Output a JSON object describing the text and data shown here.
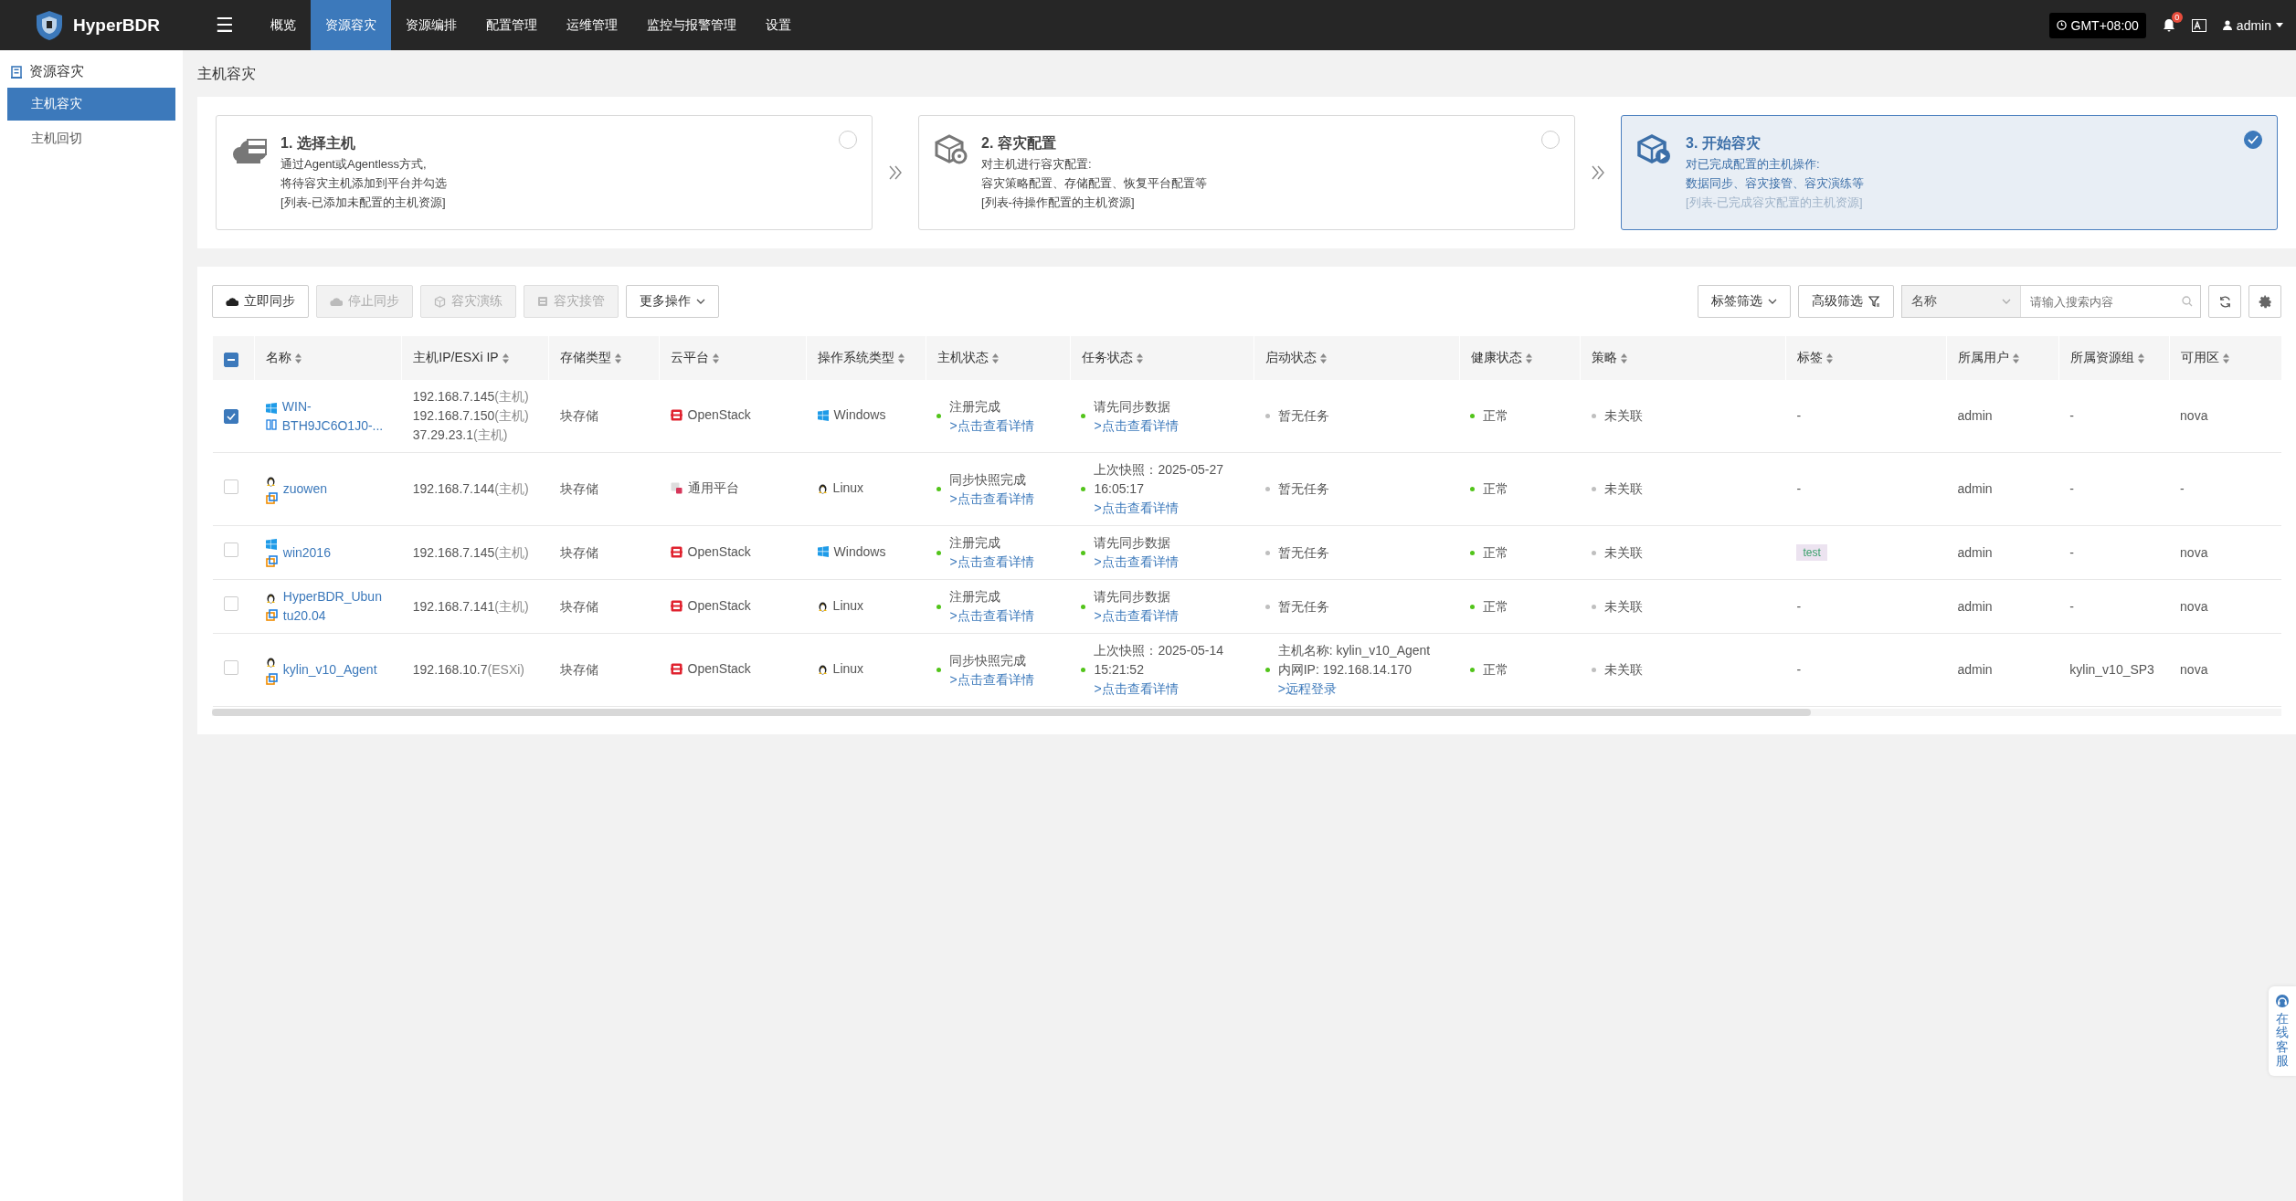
{
  "topbar": {
    "brand": "HyperBDR",
    "menu_icon": "☰",
    "nav": [
      {
        "label": "概览",
        "selected": false
      },
      {
        "label": "资源容灾",
        "selected": true
      },
      {
        "label": "资源编排",
        "selected": false
      },
      {
        "label": "配置管理",
        "selected": false
      },
      {
        "label": "运维管理",
        "selected": false
      },
      {
        "label": "监控与报警管理",
        "selected": false
      },
      {
        "label": "设置",
        "selected": false
      }
    ],
    "timezone": "GMT+08:00",
    "alert_count": "0",
    "user": "admin"
  },
  "sidebar": {
    "section": "资源容灾",
    "items": [
      {
        "label": "主机容灾",
        "selected": true
      },
      {
        "label": "主机回切",
        "selected": false
      }
    ]
  },
  "page_title": "主机容灾",
  "steps": [
    {
      "kind": "cloud",
      "title": "1. 选择主机",
      "lines": [
        "通过Agent或Agentless方式,",
        "将待容灾主机添加到平台并勾选"
      ],
      "note": "[列表-已添加未配置的主机资源]",
      "selected": false
    },
    {
      "kind": "config",
      "title": "2. 容灾配置",
      "lines": [
        "对主机进行容灾配置:",
        "容灾策略配置、存储配置、恢复平台配置等"
      ],
      "note": "[列表-待操作配置的主机资源]",
      "selected": false
    },
    {
      "kind": "start",
      "title": "3. 开始容灾",
      "lines": [
        "对已完成配置的主机操作:",
        "数据同步、容灾接管、容灾演练等"
      ],
      "note": "[列表-已完成容灾配置的主机资源]",
      "selected": true
    }
  ],
  "toolbar": {
    "actions": [
      {
        "kind": "sync",
        "label": "立即同步",
        "disabled": false
      },
      {
        "kind": "stop",
        "label": "停止同步",
        "disabled": true
      },
      {
        "kind": "drill",
        "label": "容灾演练",
        "disabled": true
      },
      {
        "kind": "takeover",
        "label": "容灾接管",
        "disabled": true
      }
    ],
    "more": "更多操作",
    "tag_filter": "标签筛选",
    "advanced_filter": "高级筛选",
    "search_field": "名称",
    "search": {
      "placeholder": "请输入搜索内容"
    }
  },
  "table": {
    "partially_selected": true,
    "columns": [
      "名称",
      "主机IP/ESXi IP",
      "存储类型",
      "云平台",
      "操作系统类型",
      "主机状态",
      "任务状态",
      "启动状态",
      "健康状态",
      "策略",
      "标签",
      "所属用户",
      "所属资源组",
      "可用区"
    ],
    "rows": [
      {
        "selected": true,
        "mode": {
          "kind": "bars"
        },
        "name_lines": [
          "WIN-",
          "BTH9JC6O1J0-..."
        ],
        "ips": [
          {
            "ip": "192.168.7.145",
            "note": "(主机)"
          },
          {
            "ip": "192.168.7.150",
            "note": "(主机)"
          },
          {
            "ip": "37.29.23.1",
            "note": "(主机)"
          }
        ],
        "storage": "块存储",
        "cloud": {
          "kind": "openstack",
          "label": "OpenStack"
        },
        "os": {
          "kind": "windows",
          "label": "Windows"
        },
        "host_status": {
          "color": "#52c41a",
          "text": "注册完成",
          "link": ">点击查看详情"
        },
        "task_status": {
          "color": "#52c41a",
          "lines": [
            "请先同步数据"
          ],
          "link": ">点击查看详情"
        },
        "boot_status": {
          "color": "#bfbfbf",
          "lines": [
            "暂无任务"
          ]
        },
        "health": {
          "color": "#52c41a",
          "text": "正常"
        },
        "policy": {
          "color": "#bfbfbf",
          "text": "未关联"
        },
        "tag": {
          "kind": "text",
          "text": "-"
        },
        "user": "admin",
        "group": "-",
        "zone": "nova"
      },
      {
        "selected": false,
        "mode": {
          "kind": "squares"
        },
        "name_lines": [
          "zuowen"
        ],
        "ips": [
          {
            "ip": "192.168.7.144",
            "note": "(主机)"
          }
        ],
        "storage": "块存储",
        "cloud": {
          "kind": "generic",
          "label": "通用平台"
        },
        "os": {
          "kind": "linux",
          "label": "Linux"
        },
        "host_status": {
          "color": "#52c41a",
          "text": "同步快照完成",
          "link": ">点击查看详情"
        },
        "task_status": {
          "color": "#52c41a",
          "lines": [
            "上次快照：2025-05-27",
            "16:05:17"
          ],
          "link": ">点击查看详情"
        },
        "boot_status": {
          "color": "#bfbfbf",
          "lines": [
            "暂无任务"
          ]
        },
        "health": {
          "color": "#52c41a",
          "text": "正常"
        },
        "policy": {
          "color": "#bfbfbf",
          "text": "未关联"
        },
        "tag": {
          "kind": "text",
          "text": "-"
        },
        "user": "admin",
        "group": "-",
        "zone": "-"
      },
      {
        "selected": false,
        "mode": {
          "kind": "squares"
        },
        "name_lines": [
          "win2016"
        ],
        "ips": [
          {
            "ip": "192.168.7.145",
            "note": "(主机)"
          }
        ],
        "storage": "块存储",
        "cloud": {
          "kind": "openstack",
          "label": "OpenStack"
        },
        "os": {
          "kind": "windows",
          "label": "Windows"
        },
        "host_status": {
          "color": "#52c41a",
          "text": "注册完成",
          "link": ">点击查看详情"
        },
        "task_status": {
          "color": "#52c41a",
          "lines": [
            "请先同步数据"
          ],
          "link": ">点击查看详情"
        },
        "boot_status": {
          "color": "#bfbfbf",
          "lines": [
            "暂无任务"
          ]
        },
        "health": {
          "color": "#52c41a",
          "text": "正常"
        },
        "policy": {
          "color": "#bfbfbf",
          "text": "未关联"
        },
        "tag": {
          "kind": "tag",
          "text": "test"
        },
        "user": "admin",
        "group": "-",
        "zone": "nova"
      },
      {
        "selected": false,
        "mode": {
          "kind": "squares"
        },
        "name_lines": [
          "HyperBDR_Ubun",
          "tu20.04"
        ],
        "ips": [
          {
            "ip": "192.168.7.141",
            "note": "(主机)"
          }
        ],
        "storage": "块存储",
        "cloud": {
          "kind": "openstack",
          "label": "OpenStack"
        },
        "os": {
          "kind": "linux",
          "label": "Linux"
        },
        "host_status": {
          "color": "#52c41a",
          "text": "注册完成",
          "link": ">点击查看详情"
        },
        "task_status": {
          "color": "#52c41a",
          "lines": [
            "请先同步数据"
          ],
          "link": ">点击查看详情"
        },
        "boot_status": {
          "color": "#bfbfbf",
          "lines": [
            "暂无任务"
          ]
        },
        "health": {
          "color": "#52c41a",
          "text": "正常"
        },
        "policy": {
          "color": "#bfbfbf",
          "text": "未关联"
        },
        "tag": {
          "kind": "text",
          "text": "-"
        },
        "user": "admin",
        "group": "-",
        "zone": "nova"
      },
      {
        "selected": false,
        "mode": {
          "kind": "squares"
        },
        "name_lines": [
          "kylin_v10_Agent"
        ],
        "ips": [
          {
            "ip": "192.168.10.7",
            "note": "(ESXi)"
          }
        ],
        "storage": "块存储",
        "cloud": {
          "kind": "openstack",
          "label": "OpenStack"
        },
        "os": {
          "kind": "linux",
          "label": "Linux"
        },
        "host_status": {
          "color": "#52c41a",
          "text": "同步快照完成",
          "link": ">点击查看详情"
        },
        "task_status": {
          "color": "#52c41a",
          "lines": [
            "上次快照：2025-05-14",
            "15:21:52"
          ],
          "link": ">点击查看详情"
        },
        "boot_status": {
          "color": "#52c41a",
          "lines": [
            "主机名称: kylin_v10_Agent",
            "内网IP: 192.168.14.170"
          ],
          "link": ">远程登录"
        },
        "health": {
          "color": "#52c41a",
          "text": "正常"
        },
        "policy": {
          "color": "#bfbfbf",
          "text": "未关联"
        },
        "tag": {
          "kind": "text",
          "text": "-"
        },
        "user": "admin",
        "group": "kylin_v10_SP3",
        "zone": "nova"
      }
    ]
  },
  "support": {
    "label": "在线客服"
  }
}
